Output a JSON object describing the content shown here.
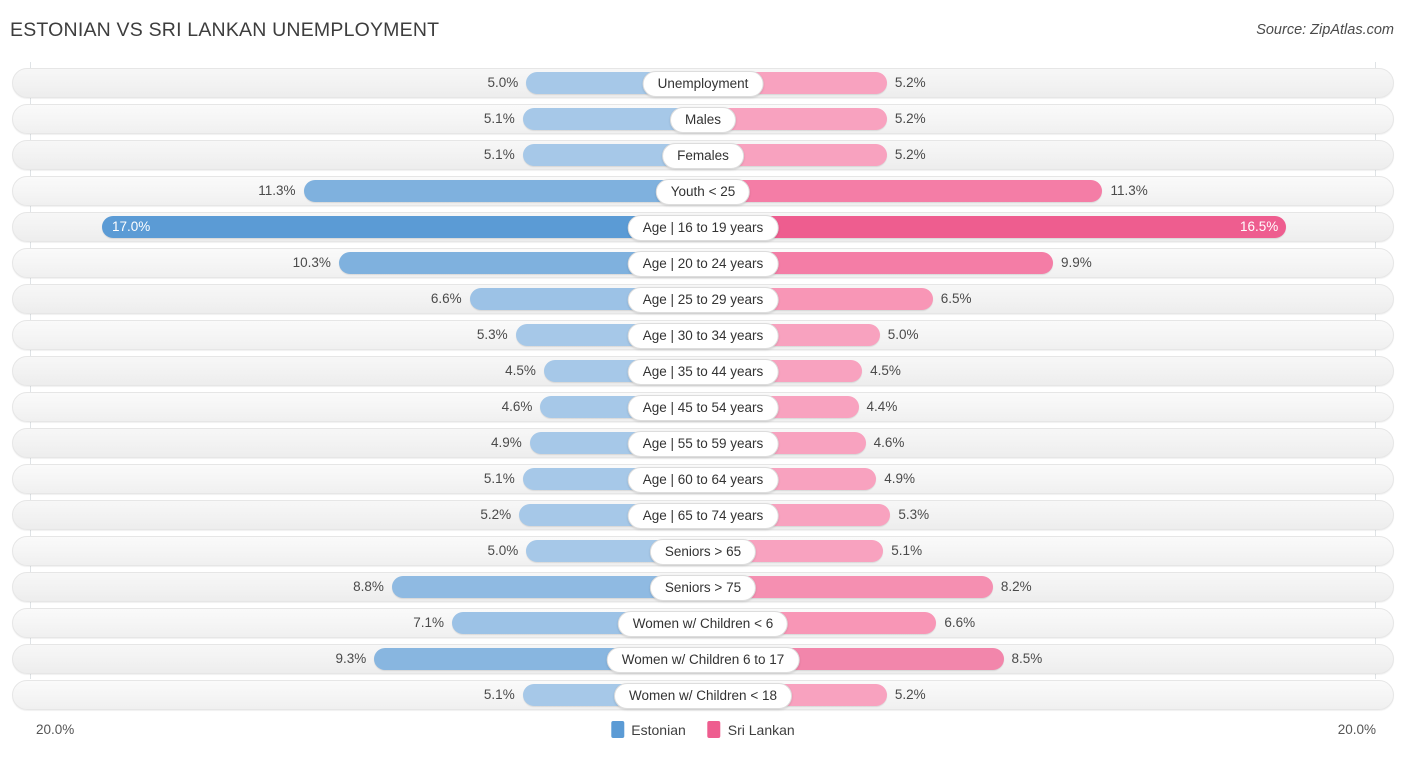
{
  "header": {
    "title": "ESTONIAN VS SRI LANKAN UNEMPLOYMENT",
    "source": "Source: ZipAtlas.com"
  },
  "footer": {
    "axis_left": "20.0%",
    "axis_right": "20.0%",
    "legend": [
      {
        "label": "Estonian",
        "color": "#5b9bd5",
        "swatch_name": "legend-swatch-estonian"
      },
      {
        "label": "Sri Lankan",
        "color": "#ee5d8f",
        "swatch_name": "legend-swatch-sri-lankan"
      }
    ]
  },
  "chart_data": {
    "type": "bar",
    "subtype": "diverging-bidirectional",
    "title": "ESTONIAN VS SRI LANKAN UNEMPLOYMENT",
    "xlabel": "",
    "ylabel": "",
    "axis_max": 20.0,
    "axis_min": 0.0,
    "units": "%",
    "grid": false,
    "legend_position": "bottom-center",
    "categories": [
      "Unemployment",
      "Males",
      "Females",
      "Youth < 25",
      "Age | 16 to 19 years",
      "Age | 20 to 24 years",
      "Age | 25 to 29 years",
      "Age | 30 to 34 years",
      "Age | 35 to 44 years",
      "Age | 45 to 54 years",
      "Age | 55 to 59 years",
      "Age | 60 to 64 years",
      "Age | 65 to 74 years",
      "Seniors > 65",
      "Seniors > 75",
      "Women w/ Children < 6",
      "Women w/ Children 6 to 17",
      "Women w/ Children < 18"
    ],
    "series": [
      {
        "name": "Estonian",
        "side": "left",
        "color": "#a6c8e8",
        "values": [
          5.0,
          5.1,
          5.1,
          11.3,
          17.0,
          10.3,
          6.6,
          5.3,
          4.5,
          4.6,
          4.9,
          5.1,
          5.2,
          5.0,
          8.8,
          7.1,
          9.3,
          5.1
        ],
        "labels": [
          "5.0%",
          "5.1%",
          "5.1%",
          "11.3%",
          "17.0%",
          "10.3%",
          "6.6%",
          "5.3%",
          "4.5%",
          "4.6%",
          "4.9%",
          "5.1%",
          "5.2%",
          "5.0%",
          "8.8%",
          "7.1%",
          "9.3%",
          "5.1%"
        ]
      },
      {
        "name": "Sri Lankan",
        "side": "right",
        "color": "#f8a2bf",
        "values": [
          5.2,
          5.2,
          5.2,
          11.3,
          16.5,
          9.9,
          6.5,
          5.0,
          4.5,
          4.4,
          4.6,
          4.9,
          5.3,
          5.1,
          8.2,
          6.6,
          8.5,
          5.2
        ],
        "labels": [
          "5.2%",
          "5.2%",
          "5.2%",
          "11.3%",
          "16.5%",
          "9.9%",
          "6.5%",
          "5.0%",
          "4.5%",
          "4.4%",
          "4.6%",
          "4.9%",
          "5.3%",
          "5.1%",
          "8.2%",
          "6.6%",
          "8.5%",
          "5.2%"
        ]
      }
    ],
    "row_styles": [
      {
        "left_color": "#a6c8e8",
        "right_color": "#f8a2bf",
        "label_inside": false
      },
      {
        "left_color": "#a6c8e8",
        "right_color": "#f8a2bf",
        "label_inside": false
      },
      {
        "left_color": "#a6c8e8",
        "right_color": "#f8a2bf",
        "label_inside": false
      },
      {
        "left_color": "#7fb1de",
        "right_color": "#f47da6",
        "label_inside": false
      },
      {
        "left_color": "#5b9bd5",
        "right_color": "#ee5d8f",
        "label_inside": true
      },
      {
        "left_color": "#7fb1de",
        "right_color": "#f47da6",
        "label_inside": false
      },
      {
        "left_color": "#9cc2e6",
        "right_color": "#f896b6",
        "label_inside": false
      },
      {
        "left_color": "#a6c8e8",
        "right_color": "#f8a2bf",
        "label_inside": false
      },
      {
        "left_color": "#a6c8e8",
        "right_color": "#f8a2bf",
        "label_inside": false
      },
      {
        "left_color": "#a6c8e8",
        "right_color": "#f8a2bf",
        "label_inside": false
      },
      {
        "left_color": "#a6c8e8",
        "right_color": "#f8a2bf",
        "label_inside": false
      },
      {
        "left_color": "#a6c8e8",
        "right_color": "#f8a2bf",
        "label_inside": false
      },
      {
        "left_color": "#a6c8e8",
        "right_color": "#f8a2bf",
        "label_inside": false
      },
      {
        "left_color": "#a6c8e8",
        "right_color": "#f8a2bf",
        "label_inside": false
      },
      {
        "left_color": "#8fbae2",
        "right_color": "#f58fb1",
        "label_inside": false
      },
      {
        "left_color": "#9cc2e6",
        "right_color": "#f896b6",
        "label_inside": false
      },
      {
        "left_color": "#88b6e0",
        "right_color": "#f286ab",
        "label_inside": false
      },
      {
        "left_color": "#a6c8e8",
        "right_color": "#f8a2bf",
        "label_inside": false
      }
    ]
  }
}
